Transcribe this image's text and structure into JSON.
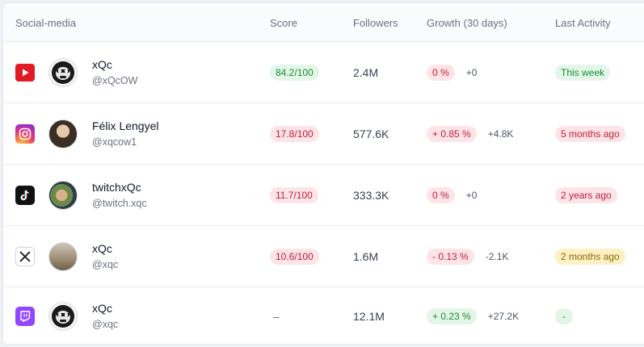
{
  "header": {
    "col_social": "Social-media",
    "col_score": "Score",
    "col_followers": "Followers",
    "col_growth": "Growth (30 days)",
    "col_last": "Last Activity"
  },
  "rows": [
    {
      "platform": "youtube-icon",
      "name": "xQc",
      "handle": "@xQcOW",
      "score": "84.2/100",
      "score_color": "green",
      "followers": "2.4M",
      "growth_pct": "0 %",
      "growth_color": "red",
      "growth_delta": "+0",
      "last": "This week",
      "last_color": "green"
    },
    {
      "platform": "instagram-icon",
      "name": "Félix Lengyel",
      "handle": "@xqcow1",
      "score": "17.8/100",
      "score_color": "red",
      "followers": "577.6K",
      "growth_pct": "+ 0.85 %",
      "growth_color": "red",
      "growth_delta": "+4.8K",
      "last": "5 months ago",
      "last_color": "red"
    },
    {
      "platform": "tiktok-icon",
      "name": "twitchxQc",
      "handle": "@twitch.xqc",
      "score": "11.7/100",
      "score_color": "red",
      "followers": "333.3K",
      "growth_pct": "0 %",
      "growth_color": "red",
      "growth_delta": "+0",
      "last": "2 years ago",
      "last_color": "red"
    },
    {
      "platform": "x-icon",
      "name": "xQc",
      "handle": "@xqc",
      "score": "10.6/100",
      "score_color": "red",
      "followers": "1.6M",
      "growth_pct": "- 0.13 %",
      "growth_color": "red",
      "growth_delta": "-2.1K",
      "last": "2 months ago",
      "last_color": "yellow"
    },
    {
      "platform": "twitch-icon",
      "name": "xQc",
      "handle": "@xqc",
      "score": "–",
      "score_color": "none",
      "followers": "12.1M",
      "growth_pct": "+ 0.23 %",
      "growth_color": "green",
      "growth_delta": "+27.2K",
      "last": "-",
      "last_color": "green"
    }
  ],
  "colors": {
    "green_bg": "#e3f6e8",
    "green_fg": "#1f8a3b",
    "red_bg": "#fde4e7",
    "red_fg": "#c21d3b",
    "yellow_bg": "#fdf0c4",
    "yellow_fg": "#8a6a00"
  }
}
